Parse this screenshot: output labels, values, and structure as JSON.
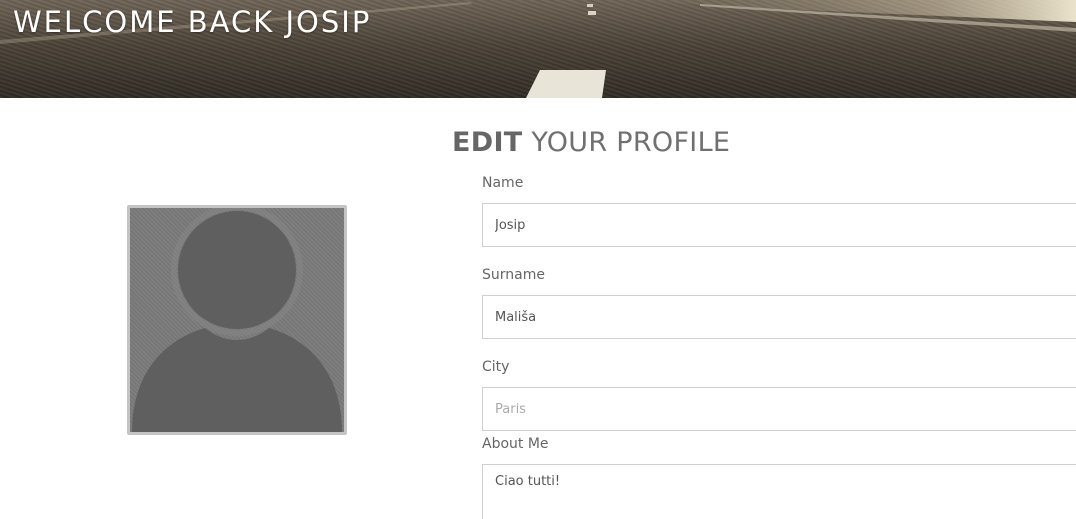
{
  "header": {
    "welcome_title": "WELCOME BACK JOSIP"
  },
  "profile": {
    "heading_bold": "EDIT",
    "heading_rest": " YOUR PROFILE",
    "avatar_icon": "default-user-silhouette-icon"
  },
  "form": {
    "name_label": "Name",
    "name_value": "Josip",
    "surname_label": "Surname",
    "surname_value": "Mališa",
    "city_label": "City",
    "city_value": "",
    "city_placeholder": "Paris",
    "about_label": "About Me",
    "about_value": "Ciao tutti!"
  },
  "colors": {
    "heading_text": "#707070",
    "input_border": "#d0d0d0",
    "avatar_bg": "#7b7b7b",
    "avatar_figure": "#616161"
  }
}
